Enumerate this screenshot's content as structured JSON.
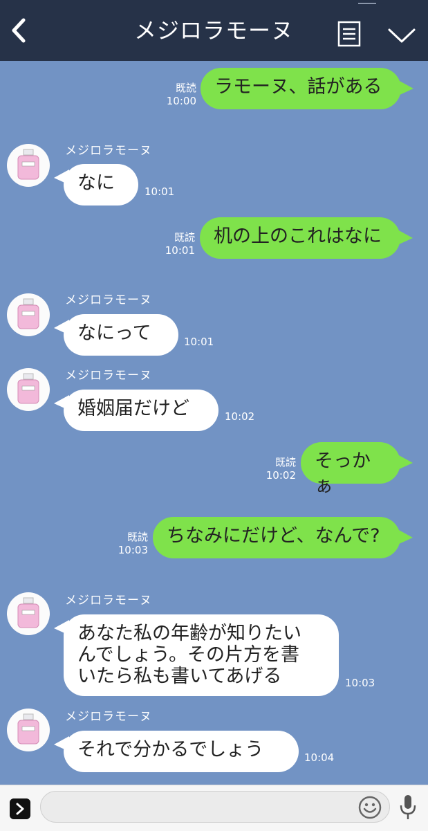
{
  "header": {
    "title": "メジロラモーヌ"
  },
  "contact_name": "メジロラモーヌ",
  "read_label": "既読",
  "messages": [
    {
      "dir": "out",
      "text": "ラモーヌ、話がある",
      "time": "10:00",
      "read": true
    },
    {
      "dir": "in",
      "text": "なに",
      "time": "10:01"
    },
    {
      "dir": "out",
      "text": "机の上のこれはなに",
      "time": "10:01",
      "read": true
    },
    {
      "dir": "in",
      "text": "なにって",
      "time": "10:01"
    },
    {
      "dir": "in",
      "text": "婚姻届だけど",
      "time": "10:02"
    },
    {
      "dir": "out",
      "text": "そっかぁ",
      "time": "10:02",
      "read": true
    },
    {
      "dir": "out",
      "text": "ちなみにだけど、なんで?",
      "time": "10:03",
      "read": true
    },
    {
      "dir": "in",
      "lines": [
        "あなた私の年齢が知りたい",
        "んでしょう。その片方を書",
        "いたら私も書いてあげる"
      ],
      "time": "10:03"
    },
    {
      "dir": "in",
      "text": "それで分かるでしょう",
      "time": "10:04"
    }
  ],
  "input": {
    "placeholder": ""
  },
  "colors": {
    "header": "#263248",
    "background": "#7293c4",
    "outgoing": "#7fe24b",
    "incoming": "#ffffff"
  },
  "icons": {
    "back": "chevron-left-icon",
    "menu": "menu-list-icon",
    "down": "chevron-down-icon",
    "expand": "expand-arrow-icon",
    "emoji": "emoji-icon",
    "mic": "microphone-icon"
  }
}
